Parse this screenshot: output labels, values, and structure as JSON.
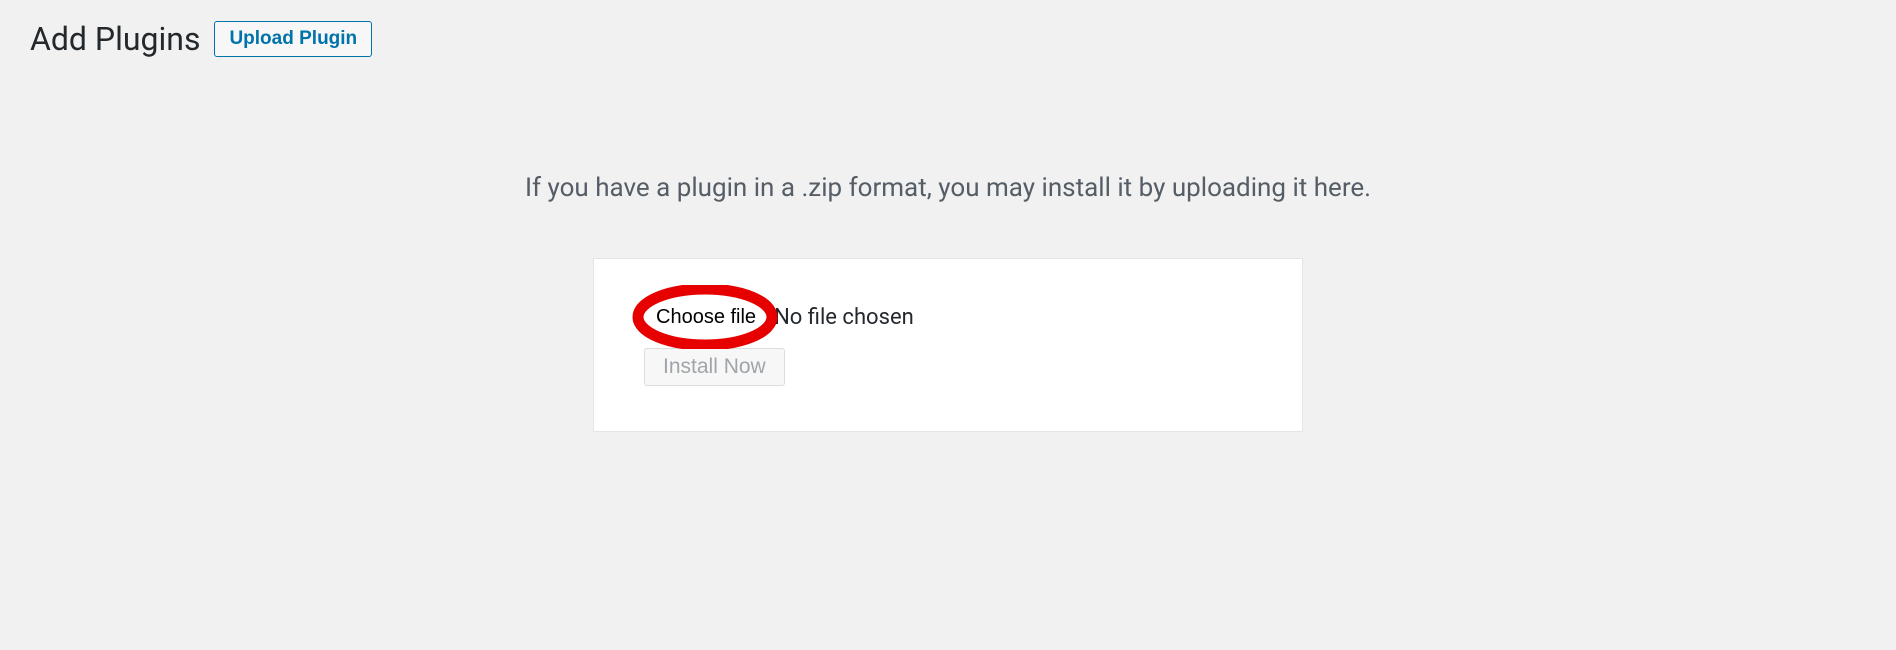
{
  "header": {
    "title": "Add Plugins",
    "upload_button": "Upload Plugin"
  },
  "upload": {
    "description": "If you have a plugin in a .zip format, you may install it by uploading it here.",
    "choose_file": "Choose file",
    "no_file": "No file chosen",
    "install_button": "Install Now"
  },
  "annotation": {
    "color": "#e60000"
  }
}
